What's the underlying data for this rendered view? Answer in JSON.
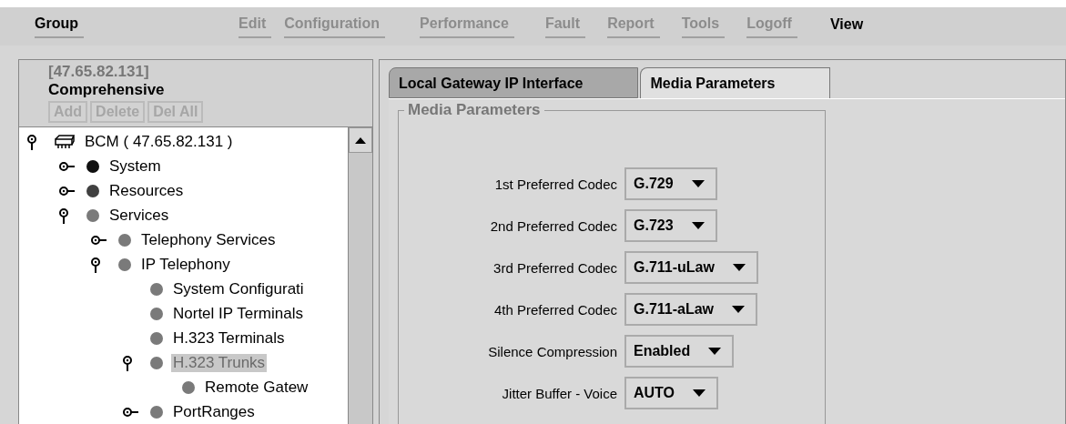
{
  "menu": [
    {
      "label": "Group",
      "disabled": false
    },
    {
      "label": "Edit",
      "disabled": true
    },
    {
      "label": "Configuration",
      "disabled": true
    },
    {
      "label": "Performance",
      "disabled": true
    },
    {
      "label": "Fault",
      "disabled": true
    },
    {
      "label": "Report",
      "disabled": true
    },
    {
      "label": "Tools",
      "disabled": true
    },
    {
      "label": "Logoff",
      "disabled": true
    },
    {
      "label": "View",
      "disabled": false
    }
  ],
  "left_panel": {
    "address": "[47.65.82.131]",
    "title": "Comprehensive",
    "buttons": [
      {
        "label": "Add",
        "disabled": true
      },
      {
        "label": "Delete",
        "disabled": true
      },
      {
        "label": "Del All",
        "disabled": true
      }
    ],
    "tree": [
      {
        "label": "BCM ( 47.65.82.131 )",
        "kind": "device",
        "expanded": true,
        "selected": false,
        "children": [
          {
            "label": "System",
            "kind": "node",
            "color": "#101010",
            "expanded": false,
            "selected": false
          },
          {
            "label": "Resources",
            "kind": "node",
            "color": "#404040",
            "expanded": false,
            "selected": false
          },
          {
            "label": "Services",
            "kind": "node",
            "color": "#7a7a7a",
            "expanded": true,
            "selected": false,
            "children": [
              {
                "label": "Telephony Services",
                "kind": "node",
                "color": "#7a7a7a",
                "expanded": false,
                "selected": false
              },
              {
                "label": "IP Telephony",
                "kind": "node",
                "color": "#7a7a7a",
                "expanded": true,
                "selected": false,
                "children": [
                  {
                    "label": "System Configurati",
                    "kind": "node",
                    "color": "#7a7a7a",
                    "selected": false
                  },
                  {
                    "label": "Nortel IP Terminals",
                    "kind": "node",
                    "color": "#7a7a7a",
                    "selected": false
                  },
                  {
                    "label": "H.323 Terminals",
                    "kind": "node",
                    "color": "#7a7a7a",
                    "selected": false
                  },
                  {
                    "label": "H.323 Trunks",
                    "kind": "node",
                    "color": "#7a7a7a",
                    "expanded": true,
                    "selected": true,
                    "children": [
                      {
                        "label": "Remote Gatew",
                        "kind": "node",
                        "color": "#7a7a7a",
                        "selected": false
                      }
                    ]
                  },
                  {
                    "label": "PortRanges",
                    "kind": "node",
                    "color": "#7a7a7a",
                    "expanded": false,
                    "selected": false
                  }
                ]
              }
            ]
          }
        ]
      }
    ]
  },
  "tabs": [
    {
      "label": "Local Gateway IP Interface",
      "selected": false
    },
    {
      "label": "Media Parameters",
      "selected": true
    }
  ],
  "group": {
    "title": "Media Parameters",
    "fields": [
      {
        "label": "1st Preferred Codec",
        "value": "G.729"
      },
      {
        "label": "2nd Preferred Codec",
        "value": "G.723"
      },
      {
        "label": "3rd Preferred Codec",
        "value": "G.711-uLaw"
      },
      {
        "label": "4th Preferred Codec",
        "value": "G.711-aLaw"
      },
      {
        "label": "Silence Compression",
        "value": "Enabled"
      },
      {
        "label": "Jitter Buffer - Voice",
        "value": "AUTO"
      }
    ]
  }
}
